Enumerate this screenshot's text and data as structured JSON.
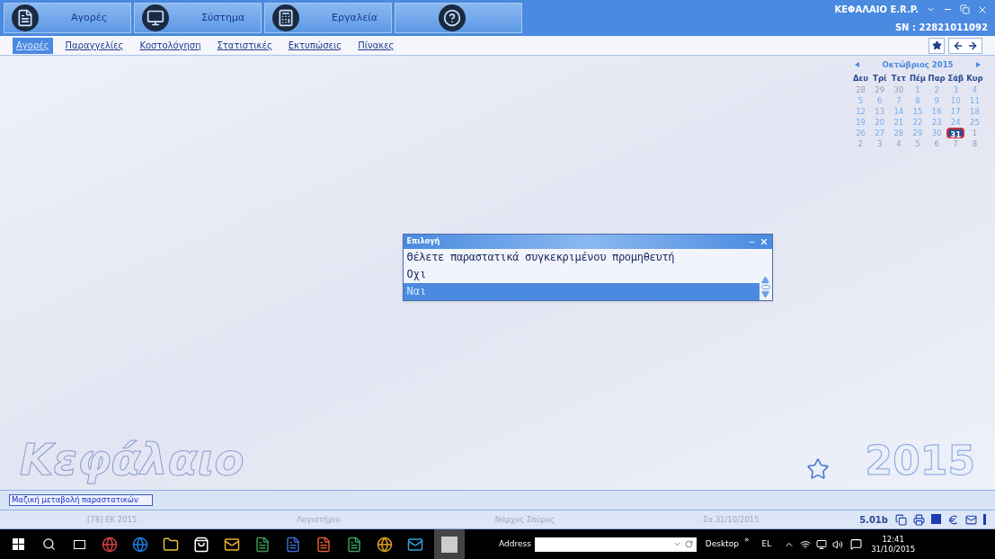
{
  "toolbar": {
    "modules": [
      {
        "label": "Αγορές",
        "kind": "documents"
      },
      {
        "label": "Σύστημα",
        "kind": "monitor"
      },
      {
        "label": "Εργαλεία",
        "kind": "calculator"
      },
      {
        "kind": "help"
      }
    ],
    "app_name": "ΚΕΦΑΛΑΙΟ E.R.P.",
    "serial": "SN : 22821011092"
  },
  "menu": [
    {
      "label": "Αγορές",
      "selected": true
    },
    {
      "label": "Παραγγελίες",
      "selected": false
    },
    {
      "label": "Κοστολόγηση",
      "selected": false
    },
    {
      "label": "Στατιστικές",
      "selected": false
    },
    {
      "label": "Εκτυπώσεις",
      "selected": false
    },
    {
      "label": "Πίνακες",
      "selected": false
    }
  ],
  "calendar": {
    "month": "Οκτώβριος 2015",
    "weekdays": [
      "Δευ",
      "Τρί",
      "Τετ",
      "Πέμ",
      "Παρ",
      "Σάβ",
      "Κυρ"
    ],
    "days": [
      {
        "d": "28",
        "outside": true,
        "selected": false
      },
      {
        "d": "29",
        "outside": true,
        "selected": false
      },
      {
        "d": "30",
        "outside": true,
        "selected": false
      },
      {
        "d": "1",
        "outside": false,
        "selected": false
      },
      {
        "d": "2",
        "outside": false,
        "selected": false
      },
      {
        "d": "3",
        "outside": false,
        "selected": false
      },
      {
        "d": "4",
        "outside": false,
        "selected": false
      },
      {
        "d": "5",
        "outside": false,
        "selected": false
      },
      {
        "d": "6",
        "outside": false,
        "selected": false
      },
      {
        "d": "7",
        "outside": false,
        "selected": false
      },
      {
        "d": "8",
        "outside": false,
        "selected": false
      },
      {
        "d": "9",
        "outside": false,
        "selected": false
      },
      {
        "d": "10",
        "outside": false,
        "selected": false
      },
      {
        "d": "11",
        "outside": false,
        "selected": false
      },
      {
        "d": "12",
        "outside": false,
        "selected": false
      },
      {
        "d": "13",
        "outside": false,
        "selected": false
      },
      {
        "d": "14",
        "outside": false,
        "selected": false
      },
      {
        "d": "15",
        "outside": false,
        "selected": false
      },
      {
        "d": "16",
        "outside": false,
        "selected": false
      },
      {
        "d": "17",
        "outside": false,
        "selected": false
      },
      {
        "d": "18",
        "outside": false,
        "selected": false
      },
      {
        "d": "19",
        "outside": false,
        "selected": false
      },
      {
        "d": "20",
        "outside": false,
        "selected": false
      },
      {
        "d": "21",
        "outside": false,
        "selected": false
      },
      {
        "d": "22",
        "outside": false,
        "selected": false
      },
      {
        "d": "23",
        "outside": false,
        "selected": false
      },
      {
        "d": "24",
        "outside": false,
        "selected": false
      },
      {
        "d": "25",
        "outside": false,
        "selected": false
      },
      {
        "d": "26",
        "outside": false,
        "selected": false
      },
      {
        "d": "27",
        "outside": false,
        "selected": false
      },
      {
        "d": "28",
        "outside": false,
        "selected": false
      },
      {
        "d": "29",
        "outside": false,
        "selected": false
      },
      {
        "d": "30",
        "outside": false,
        "selected": false
      },
      {
        "d": "31",
        "outside": false,
        "selected": true
      },
      {
        "d": "1",
        "outside": true,
        "selected": false
      },
      {
        "d": "2",
        "outside": true,
        "selected": false
      },
      {
        "d": "3",
        "outside": true,
        "selected": false
      },
      {
        "d": "4",
        "outside": true,
        "selected": false
      },
      {
        "d": "5",
        "outside": true,
        "selected": false
      },
      {
        "d": "6",
        "outside": true,
        "selected": false
      },
      {
        "d": "7",
        "outside": true,
        "selected": false
      },
      {
        "d": "8",
        "outside": true,
        "selected": false
      }
    ]
  },
  "dialog": {
    "title": "Επιλογή",
    "question": "Θέλετε παραστατικά συγκεκριμένου προμηθευτή",
    "options": [
      {
        "label": "Οχι",
        "selected": false
      },
      {
        "label": "Ναι",
        "selected": true
      }
    ]
  },
  "logo_text": "Κεφάλαιο",
  "year": "2015",
  "action_button": "Μαζική μεταβολή παραστατικών",
  "status_bar": {
    "fields": [
      "[78] ΕΚ 2015",
      "Λογιστήριο",
      "Νάρχος Σπύρος",
      "Σα 31/10/2015"
    ],
    "version": "5.01b"
  },
  "taskbar": {
    "address_label": "Address",
    "desktop_label": "Desktop",
    "more": "»",
    "language": "EL",
    "time": "12:41",
    "date": "31/10/2015"
  }
}
